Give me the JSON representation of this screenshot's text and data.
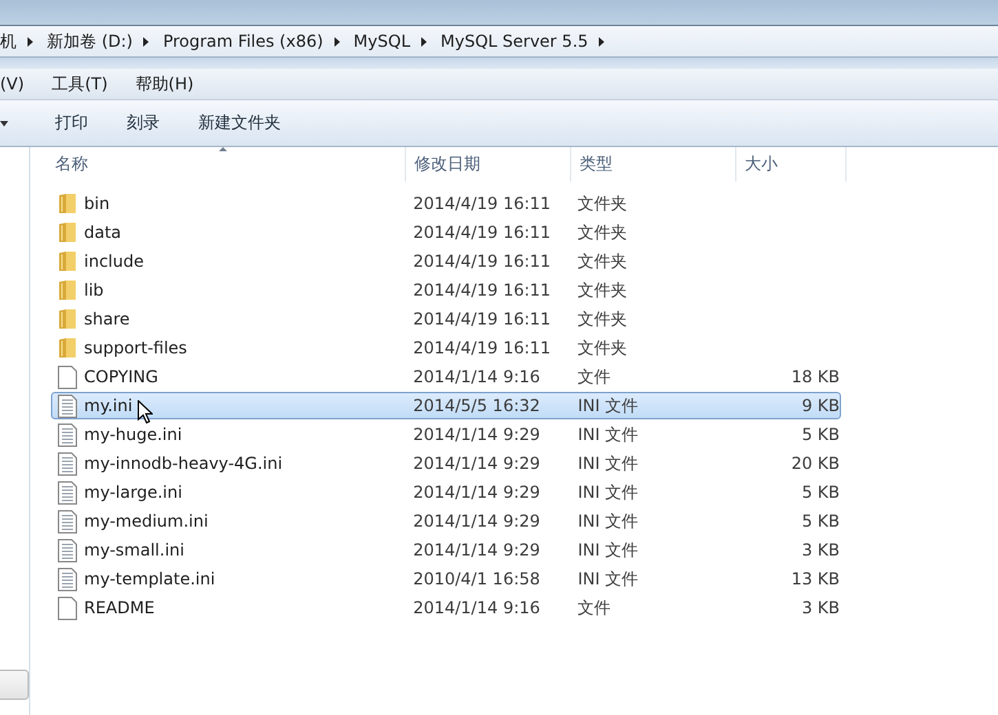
{
  "breadcrumb": [
    "机",
    "新加卷 (D:)",
    "Program Files (x86)",
    "MySQL",
    "MySQL Server 5.5"
  ],
  "menu": [
    "(V)",
    "工具(T)",
    "帮助(H)"
  ],
  "toolbar": [
    "打印",
    "刻录",
    "新建文件夹"
  ],
  "columns": [
    "名称",
    "修改日期",
    "类型",
    "大小"
  ],
  "rows": [
    {
      "kind": "folder",
      "name": "bin",
      "date": "2014/4/19 16:11",
      "type": "文件夹",
      "selected": false
    },
    {
      "kind": "folder",
      "name": "data",
      "date": "2014/4/19 16:11",
      "type": "文件夹",
      "selected": false
    },
    {
      "kind": "folder",
      "name": "include",
      "date": "2014/4/19 16:11",
      "type": "文件夹",
      "selected": false
    },
    {
      "kind": "folder",
      "name": "lib",
      "date": "2014/4/19 16:11",
      "type": "文件夹",
      "selected": false
    },
    {
      "kind": "folder",
      "name": "share",
      "date": "2014/4/19 16:11",
      "type": "文件夹",
      "selected": false
    },
    {
      "kind": "folder",
      "name": "support-files",
      "date": "2014/4/19 16:11",
      "type": "文件夹",
      "selected": false
    },
    {
      "kind": "file",
      "name": "COPYING",
      "date": "2014/1/14 9:16",
      "type": "文件",
      "size": "18 KB",
      "selected": false
    },
    {
      "kind": "ini",
      "name": "my.ini",
      "date": "2014/5/5 16:32",
      "type": "INI 文件",
      "size": "9 KB",
      "selected": true
    },
    {
      "kind": "ini",
      "name": "my-huge.ini",
      "date": "2014/1/14 9:29",
      "type": "INI 文件",
      "size": "5 KB",
      "selected": false
    },
    {
      "kind": "ini",
      "name": "my-innodb-heavy-4G.ini",
      "date": "2014/1/14 9:29",
      "type": "INI 文件",
      "size": "20 KB",
      "selected": false
    },
    {
      "kind": "ini",
      "name": "my-large.ini",
      "date": "2014/1/14 9:29",
      "type": "INI 文件",
      "size": "5 KB",
      "selected": false
    },
    {
      "kind": "ini",
      "name": "my-medium.ini",
      "date": "2014/1/14 9:29",
      "type": "INI 文件",
      "size": "5 KB",
      "selected": false
    },
    {
      "kind": "ini",
      "name": "my-small.ini",
      "date": "2014/1/14 9:29",
      "type": "INI 文件",
      "size": "3 KB",
      "selected": false
    },
    {
      "kind": "ini",
      "name": "my-template.ini",
      "date": "2010/4/1 16:58",
      "type": "INI 文件",
      "size": "13 KB",
      "selected": false
    },
    {
      "kind": "file",
      "name": "README",
      "date": "2014/1/14 9:16",
      "type": "文件",
      "size": "3 KB",
      "selected": false
    }
  ]
}
